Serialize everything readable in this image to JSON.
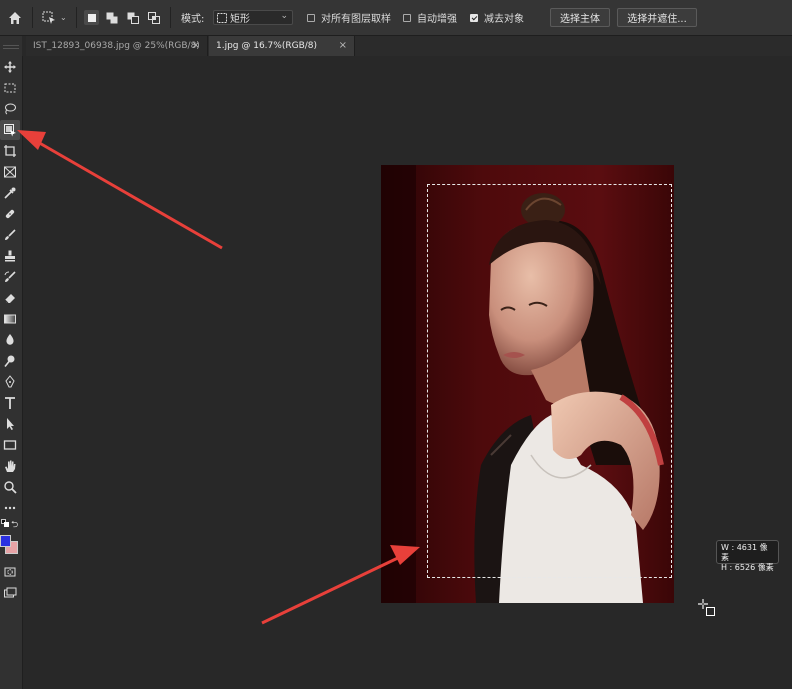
{
  "options_bar": {
    "mode_label": "模式:",
    "mode_value": "矩形",
    "sample_all_layers": "对所有图层取样",
    "sample_all_layers_checked": false,
    "auto_enhance": "自动增强",
    "auto_enhance_checked": false,
    "subtract_object": "减去对象",
    "subtract_object_checked": true,
    "select_subject": "选择主体",
    "select_and_mask": "选择并遮住..."
  },
  "tabs": [
    {
      "label": "IST_12893_06938.jpg @ 25%(RGB/8)",
      "active": false
    },
    {
      "label": "1.jpg @ 16.7%(RGB/8)",
      "active": true
    }
  ],
  "tools": [
    "move-tool-icon",
    "rectangular-marquee-icon",
    "lasso-icon",
    "object-selection-icon",
    "crop-icon",
    "frame-icon",
    "eyedropper-icon",
    "healing-brush-icon",
    "brush-icon",
    "clone-stamp-icon",
    "history-brush-icon",
    "eraser-icon",
    "gradient-icon",
    "blur-icon",
    "dodge-icon",
    "pen-icon",
    "type-icon",
    "path-selection-icon",
    "rectangle-icon",
    "hand-icon",
    "zoom-icon",
    "more-tools-icon"
  ],
  "colors": {
    "foreground": "#2b30e0",
    "background": "#e7a3a6",
    "annotation_arrow": "#e8403a",
    "ui_panel": "#353535",
    "canvas_bg": "#282828"
  },
  "size_tooltip": {
    "width": "W : 4631 像素",
    "height": "H : 6526 像素"
  }
}
